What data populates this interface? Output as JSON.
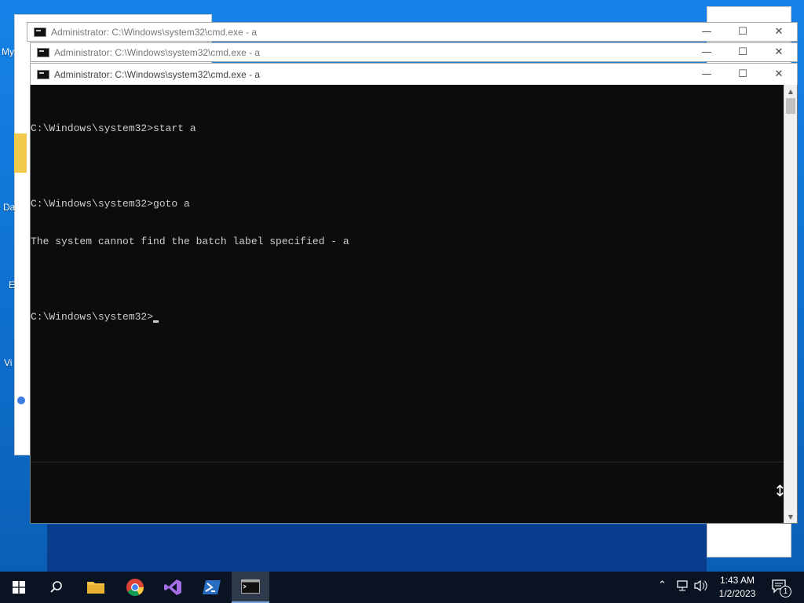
{
  "desktop": {
    "icon_labels": [
      "My",
      "Da",
      "E",
      "Vi"
    ]
  },
  "windows": [
    {
      "title": "Administrator: C:\\Windows\\system32\\cmd.exe - a"
    },
    {
      "title": "Administrator: C:\\Windows\\system32\\cmd.exe - a"
    },
    {
      "title": "Administrator: C:\\Windows\\system32\\cmd.exe - a"
    }
  ],
  "window_controls": {
    "minimize": "—",
    "maximize": "☐",
    "close": "✕"
  },
  "console": {
    "lines": [
      "C:\\Windows\\system32>start a",
      "",
      "C:\\Windows\\system32>goto a",
      "The system cannot find the batch label specified - a",
      "",
      "C:\\Windows\\system32>"
    ]
  },
  "taskbar": {
    "apps": [
      "start-button",
      "search",
      "file-explorer",
      "chrome",
      "visual-studio",
      "powershell",
      "command-prompt"
    ],
    "clock_time": "1:43 AM",
    "clock_date": "1/2/2023",
    "notification_count": "1"
  }
}
